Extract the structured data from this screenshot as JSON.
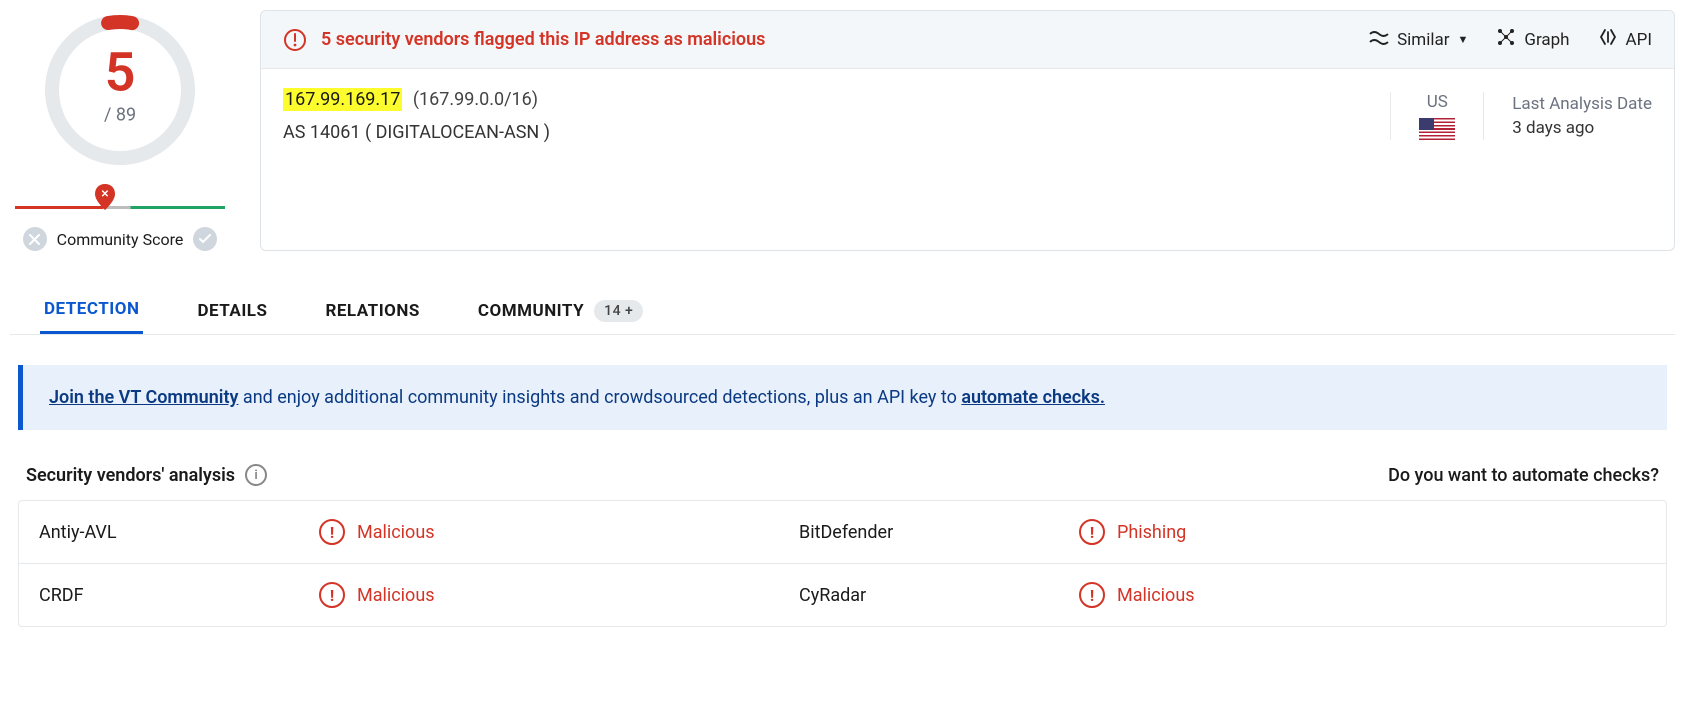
{
  "score": {
    "detected": "5",
    "total": "/ 89"
  },
  "community_score_label": "Community Score",
  "summary": {
    "flag_message": "5 security vendors flagged this IP address as malicious",
    "actions": {
      "similar": "Similar",
      "graph": "Graph",
      "api": "API"
    },
    "ip": "167.99.169.17",
    "ip_range": "(167.99.0.0/16)",
    "asn": "AS 14061  ( DIGITALOCEAN-ASN )",
    "country_code": "US",
    "analysis_label": "Last Analysis Date",
    "analysis_time": "3 days ago"
  },
  "tabs": {
    "detection": "DETECTION",
    "details": "DETAILS",
    "relations": "RELATIONS",
    "community": "COMMUNITY",
    "community_count": "14 +"
  },
  "banner": {
    "link_join": "Join the VT Community",
    "mid": " and enjoy additional community insights and crowdsourced detections, plus an API key to ",
    "link_automate": "automate checks."
  },
  "vendors_section": {
    "title": "Security vendors' analysis",
    "automate": "Do you want to automate checks?"
  },
  "vendors": [
    {
      "name": "Antiy-AVL",
      "verdict": "Malicious"
    },
    {
      "name": "BitDefender",
      "verdict": "Phishing"
    },
    {
      "name": "CRDF",
      "verdict": "Malicious"
    },
    {
      "name": "CyRadar",
      "verdict": "Malicious"
    }
  ]
}
